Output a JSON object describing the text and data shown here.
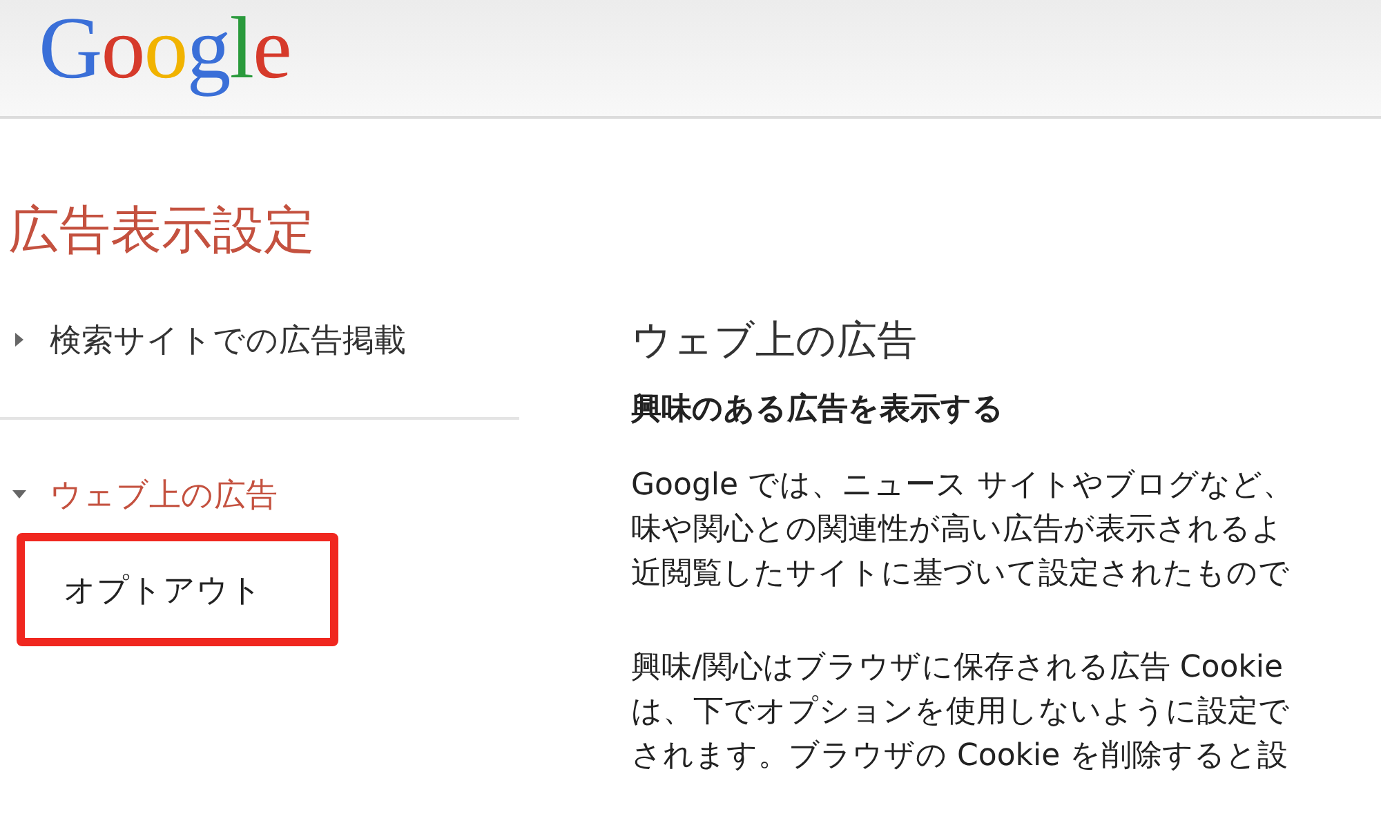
{
  "header": {
    "logo": "Google"
  },
  "page_title": "広告表示設定",
  "sidebar": {
    "items": [
      {
        "label": "検索サイトでの広告掲載",
        "expanded": false,
        "selected": false
      },
      {
        "label": "ウェブ上の広告",
        "expanded": true,
        "selected": true,
        "children": [
          {
            "label": "オプトアウト",
            "highlighted": true
          }
        ]
      }
    ]
  },
  "content": {
    "heading": "ウェブ上の広告",
    "subheading": "興味のある広告を表示する",
    "paragraphs": [
      {
        "lines": [
          "Google では、ニュース サイトやブログなど、",
          "味や関心との関連性が高い広告が表示されるよ",
          "近閲覧したサイトに基づいて設定されたもので"
        ]
      },
      {
        "lines": [
          "興味/関心はブラウザに保存される広告 Cookie",
          "は、下でオプションを使用しないように設定で",
          "されます。ブラウザの Cookie を削除すると設"
        ]
      }
    ]
  }
}
